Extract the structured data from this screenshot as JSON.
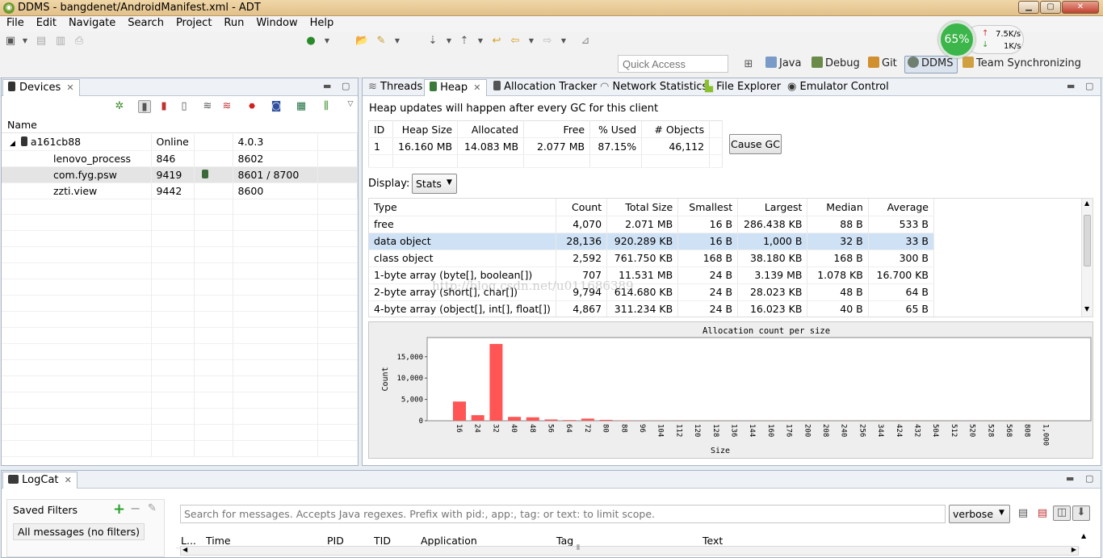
{
  "window": {
    "title": "DDMS - bangdenet/AndroidManifest.xml - ADT"
  },
  "menu": [
    "File",
    "Edit",
    "Navigate",
    "Search",
    "Project",
    "Run",
    "Window",
    "Help"
  ],
  "quick_access": {
    "placeholder": "Quick Access"
  },
  "perspectives": [
    "Java",
    "Debug",
    "Git",
    "DDMS",
    "Team Synchronizing"
  ],
  "net_monitor": {
    "percent": "65%",
    "up": "7.5K/s",
    "down": "1K/s",
    "accent": "#3cb54a"
  },
  "devices": {
    "tab": "Devices",
    "column_name": "Name",
    "rows": [
      {
        "name": "a161cb88",
        "c2": "Online",
        "c3": "",
        "c4": "4.0.3"
      },
      {
        "name": "lenovo_process",
        "c2": "846",
        "c3": "",
        "c4": "8602"
      },
      {
        "name": "com.fyg.psw",
        "c2": "9419",
        "c3": "heap-icon",
        "c4": "8601 / 8700"
      },
      {
        "name": "zzti.view",
        "c2": "9442",
        "c3": "",
        "c4": "8600"
      }
    ]
  },
  "tabs": [
    "Threads",
    "Heap",
    "Allocation Tracker",
    "Network Statistics",
    "File Explorer",
    "Emulator Control"
  ],
  "heap": {
    "info": "Heap updates will happen after every GC for this client",
    "summary_headers": [
      "ID",
      "Heap Size",
      "Allocated",
      "Free",
      "% Used",
      "# Objects"
    ],
    "summary_row": [
      "1",
      "16.160 MB",
      "14.083 MB",
      "2.077 MB",
      "87.15%",
      "46,112"
    ],
    "cause_gc": "Cause GC",
    "display_label": "Display:",
    "display_value": "Stats",
    "stats_headers": [
      "Type",
      "Count",
      "Total Size",
      "Smallest",
      "Largest",
      "Median",
      "Average"
    ],
    "stats_rows": [
      [
        "free",
        "4,070",
        "2.071 MB",
        "16 B",
        "286.438 KB",
        "88 B",
        "533 B"
      ],
      [
        "data object",
        "28,136",
        "920.289 KB",
        "16 B",
        "1,000 B",
        "32 B",
        "33 B"
      ],
      [
        "class object",
        "2,592",
        "761.750 KB",
        "168 B",
        "38.180 KB",
        "168 B",
        "300 B"
      ],
      [
        "1-byte array (byte[], boolean[])",
        "707",
        "11.531 MB",
        "24 B",
        "3.139 MB",
        "1.078 KB",
        "16.700 KB"
      ],
      [
        "2-byte array (short[], char[])",
        "9,794",
        "614.680 KB",
        "24 B",
        "28.023 KB",
        "48 B",
        "64 B"
      ],
      [
        "4-byte array (object[], int[], float[])",
        "4,867",
        "311.234 KB",
        "24 B",
        "16.023 KB",
        "40 B",
        "65 B"
      ]
    ],
    "selected_row": 1
  },
  "watermark": "http://blog.csdn.net/u011686389",
  "chart_data": {
    "type": "bar",
    "title": "Allocation count per size",
    "xlabel": "Size",
    "ylabel": "Count",
    "ylim": [
      0,
      19500
    ],
    "yticks": [
      "0",
      "5,000",
      "10,000",
      "15,000"
    ],
    "ytick_values": [
      0,
      5000,
      10000,
      15000
    ],
    "categories": [
      "16",
      "24",
      "32",
      "40",
      "48",
      "56",
      "64",
      "72",
      "80",
      "88",
      "96",
      "104",
      "112",
      "120",
      "128",
      "136",
      "144",
      "160",
      "176",
      "200",
      "208",
      "240",
      "256",
      "344",
      "424",
      "432",
      "504",
      "512",
      "520",
      "528",
      "568",
      "808",
      "1,000"
    ],
    "values": [
      4500,
      1300,
      18000,
      900,
      800,
      300,
      150,
      500,
      200,
      80,
      40,
      30,
      30,
      20,
      20,
      20,
      20,
      20,
      20,
      20,
      20,
      20,
      20,
      20,
      20,
      20,
      20,
      20,
      20,
      20,
      20,
      20,
      20
    ],
    "bar_color": "#ff5555"
  },
  "logcat": {
    "tab": "LogCat",
    "saved_filters": "Saved Filters",
    "all_messages": "All messages (no filters)",
    "search_placeholder": "Search for messages. Accepts Java regexes. Prefix with pid:, app:, tag: or text: to limit scope.",
    "level": "verbose",
    "columns": [
      "L...",
      "Time",
      "PID",
      "TID",
      "Application",
      "Tag",
      "Text"
    ]
  }
}
